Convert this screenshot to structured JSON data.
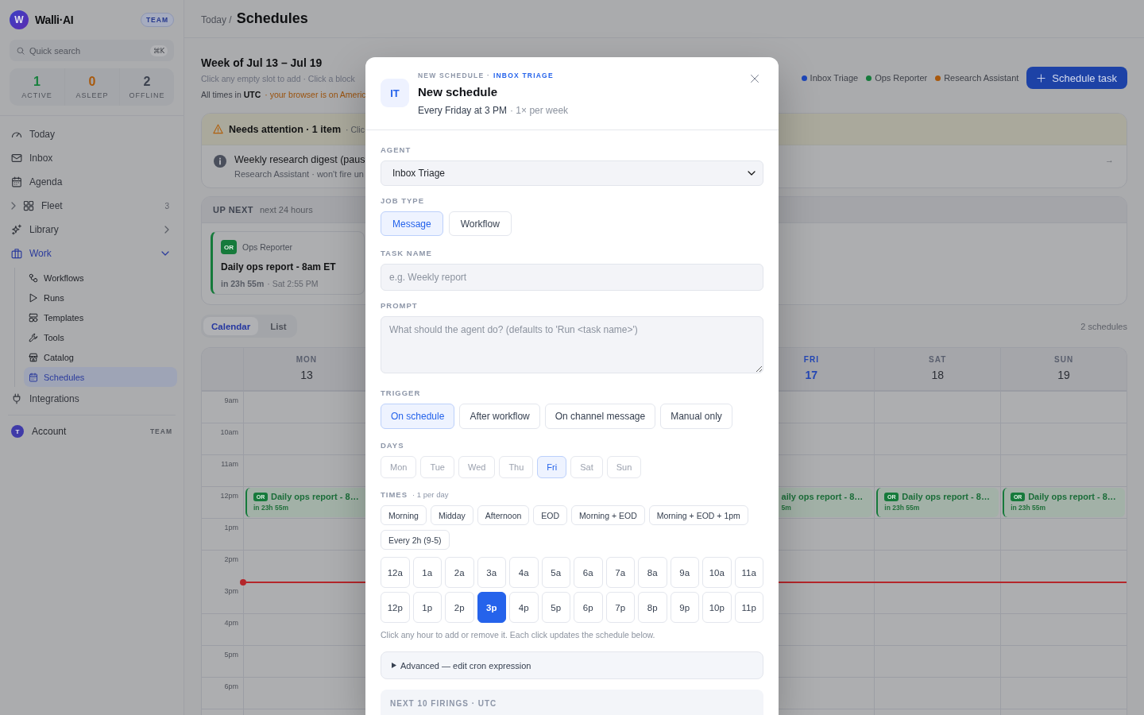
{
  "sidebar": {
    "brand": {
      "logo": "W",
      "name": "Walli·AI",
      "plan": "TEAM"
    },
    "search": {
      "placeholder": "Quick search",
      "shortcut": "⌘K"
    },
    "stats": [
      {
        "value": "1",
        "label": "ACTIVE",
        "color": "#17803d"
      },
      {
        "value": "0",
        "label": "ASLEEP",
        "color": "#a85a0e"
      },
      {
        "value": "2",
        "label": "OFFLINE",
        "color": "#3d4350"
      }
    ],
    "nav": [
      {
        "label": "Today",
        "kind": "link",
        "selected": false
      },
      {
        "label": "Inbox",
        "kind": "link",
        "selected": false
      },
      {
        "label": "Agenda",
        "kind": "link",
        "selected": false
      },
      {
        "label": "Fleet",
        "kind": "counted",
        "count": "3",
        "expanded": false,
        "selected": false
      },
      {
        "label": "Library",
        "kind": "folder",
        "expanded": false,
        "selected": false
      },
      {
        "label": "Work",
        "kind": "folder",
        "expanded": true,
        "selected": true,
        "children": [
          {
            "label": "Workflows",
            "selected": false
          },
          {
            "label": "Runs",
            "selected": false
          },
          {
            "label": "Templates",
            "selected": false
          },
          {
            "label": "Tools",
            "selected": false
          },
          {
            "label": "Catalog",
            "selected": false
          },
          {
            "label": "Schedules",
            "selected": true
          }
        ]
      },
      {
        "label": "Integrations",
        "kind": "link",
        "selected": false
      }
    ],
    "account": {
      "initial": "T",
      "label": "Account",
      "plan": "TEAM"
    }
  },
  "header": {
    "breadcrumb": "Today /",
    "title": "Schedules"
  },
  "week": {
    "title": "Week of Jul 13 – Jul 19",
    "hint": "Click any empty slot to add · Click a block",
    "timezone": "All times in **UTC**",
    "browser_note": "· your browser is on Americ"
  },
  "legend": [
    {
      "name": "Inbox Triage",
      "color": "#1e46b8"
    },
    {
      "name": "Ops Reporter",
      "color": "#167a3b"
    },
    {
      "name": "Research Assistant",
      "color": "#a8580c"
    }
  ],
  "schedule_button": "Schedule task",
  "attention": {
    "title": "Needs attention · 1 item",
    "hint": "· Clic",
    "items": [
      {
        "title": "Weekly research digest (paus",
        "detail": "Research Assistant · won't fire un",
        "arrow": "→"
      }
    ]
  },
  "up_next": {
    "title": "UP NEXT",
    "subtitle": "next 24 hours",
    "items": [
      {
        "tag": "OR",
        "agent": "Ops Reporter",
        "title": "Daily ops report - 8am ET",
        "eta": "in 23h 55m",
        "when": "· Sat 2:55 PM"
      }
    ]
  },
  "view_tabs": [
    {
      "label": "Calendar",
      "selected": true
    },
    {
      "label": "List",
      "selected": false
    }
  ],
  "schedule_count": "2 schedules",
  "calendar": {
    "days": [
      {
        "name": "MON",
        "date": "13",
        "today": false
      },
      {
        "name": "FRI",
        "date": "17",
        "today": true
      },
      {
        "name": "SAT",
        "date": "18",
        "today": false
      },
      {
        "name": "SUN",
        "date": "19",
        "today": false
      }
    ],
    "rows": [
      {
        "time": "9am",
        "now": false
      },
      {
        "time": "10am",
        "now": false
      },
      {
        "time": "11am",
        "now": false
      },
      {
        "time": "12pm",
        "now": false,
        "events": [
          {
            "tag": "OR",
            "title": "Daily ops report - 8…",
            "eta": "in 23h 55m"
          },
          {
            "title": "aily ops report - 8…",
            "eta": "5m"
          },
          {
            "tag": "OR",
            "title": "Daily ops report - 8…",
            "eta": "in 23h 55m"
          },
          {
            "tag": "OR",
            "title": "Daily ops report - 8…",
            "eta": "in 23h 55m"
          }
        ]
      },
      {
        "time": "1pm",
        "now": false
      },
      {
        "time": "2pm",
        "now": true
      },
      {
        "time": "3pm",
        "now": false
      },
      {
        "time": "4pm",
        "now": false
      },
      {
        "time": "5pm",
        "now": false
      },
      {
        "time": "6pm",
        "now": false
      }
    ]
  },
  "dialog": {
    "avatar": "IT",
    "eyebrow": "NEW SCHEDULE ·",
    "agent_tag": "INBOX TRIAGE",
    "title": "New schedule",
    "summary": "Every Friday at 3 PM",
    "frequency": "· 1× per week",
    "agent": {
      "label": "AGENT",
      "value": "Inbox Triage"
    },
    "job_type": {
      "label": "JOB TYPE",
      "options": [
        {
          "label": "Message",
          "selected": true
        },
        {
          "label": "Workflow",
          "selected": false
        }
      ]
    },
    "task_name": {
      "label": "TASK NAME",
      "placeholder": "e.g. Weekly report"
    },
    "prompt": {
      "label": "PROMPT",
      "placeholder": "What should the agent do? (defaults to 'Run <task name>')"
    },
    "trigger": {
      "label": "TRIGGER",
      "options": [
        {
          "label": "On schedule",
          "selected": true
        },
        {
          "label": "After workflow",
          "selected": false
        },
        {
          "label": "On channel message",
          "selected": false
        },
        {
          "label": "Manual only",
          "selected": false
        }
      ]
    },
    "days": {
      "label": "DAYS",
      "options": [
        {
          "label": "Mon",
          "selected": false
        },
        {
          "label": "Tue",
          "selected": false
        },
        {
          "label": "Wed",
          "selected": false
        },
        {
          "label": "Thu",
          "selected": false
        },
        {
          "label": "Fri",
          "selected": true
        },
        {
          "label": "Sat",
          "selected": false
        },
        {
          "label": "Sun",
          "selected": false
        }
      ]
    },
    "times": {
      "label": "TIMES",
      "note": "· 1 per day",
      "presets": [
        "Morning",
        "Midday",
        "Afternoon",
        "EOD",
        "Morning + EOD",
        "Morning + EOD + 1pm",
        "Every 2h (9-5)"
      ],
      "hours": [
        {
          "label": "12a",
          "selected": false
        },
        {
          "label": "1a",
          "selected": false
        },
        {
          "label": "2a",
          "selected": false
        },
        {
          "label": "3a",
          "selected": false
        },
        {
          "label": "4a",
          "selected": false
        },
        {
          "label": "5a",
          "selected": false
        },
        {
          "label": "6a",
          "selected": false
        },
        {
          "label": "7a",
          "selected": false
        },
        {
          "label": "8a",
          "selected": false
        },
        {
          "label": "9a",
          "selected": false
        },
        {
          "label": "10a",
          "selected": false
        },
        {
          "label": "11a",
          "selected": false
        },
        {
          "label": "12p",
          "selected": false
        },
        {
          "label": "1p",
          "selected": false
        },
        {
          "label": "2p",
          "selected": false
        },
        {
          "label": "3p",
          "selected": true
        },
        {
          "label": "4p",
          "selected": false
        },
        {
          "label": "5p",
          "selected": false
        },
        {
          "label": "6p",
          "selected": false
        },
        {
          "label": "7p",
          "selected": false
        },
        {
          "label": "8p",
          "selected": false
        },
        {
          "label": "9p",
          "selected": false
        },
        {
          "label": "10p",
          "selected": false
        },
        {
          "label": "11p",
          "selected": false
        }
      ],
      "hint": "Click any hour to add or remove it. Each click updates the schedule below."
    },
    "advanced": {
      "label": "Advanced — edit cron expression",
      "expanded": false
    },
    "firings": {
      "title": "NEXT 10 FIRINGS · UTC"
    }
  }
}
